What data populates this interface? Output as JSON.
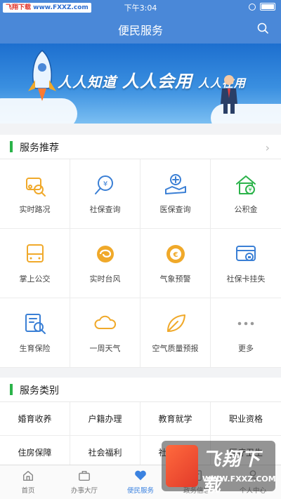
{
  "watermark_top": {
    "brand": "飞翔下载",
    "url": "www.FXXZ.com"
  },
  "status": {
    "time": "下午3:04"
  },
  "header": {
    "title": "便民服务"
  },
  "banner": {
    "slogan_1": "人人知道",
    "slogan_2": "人人会用",
    "slogan_3": "人人在用"
  },
  "recommend": {
    "title": "服务推荐",
    "items": [
      {
        "label": "实时路况",
        "icon": "car-search-icon",
        "color": "#f0a92a"
      },
      {
        "label": "社保查询",
        "icon": "social-security-search-icon",
        "color": "#3a7fd5"
      },
      {
        "label": "医保查询",
        "icon": "medical-insurance-icon",
        "color": "#3a7fd5"
      },
      {
        "label": "公积金",
        "icon": "housing-fund-icon",
        "color": "#2bb34a"
      },
      {
        "label": "掌上公交",
        "icon": "bus-icon",
        "color": "#f0a92a"
      },
      {
        "label": "实时台风",
        "icon": "typhoon-icon",
        "color": "#f0a92a"
      },
      {
        "label": "气象预警",
        "icon": "weather-warning-icon",
        "color": "#f0a92a"
      },
      {
        "label": "社保卡挂失",
        "icon": "card-lock-icon",
        "color": "#3a7fd5"
      },
      {
        "label": "生育保险",
        "icon": "maternity-insurance-icon",
        "color": "#3a7fd5"
      },
      {
        "label": "一周天气",
        "icon": "cloud-icon",
        "color": "#f0a92a"
      },
      {
        "label": "空气质量预报",
        "icon": "leaf-icon",
        "color": "#f0a92a"
      },
      {
        "label": "更多",
        "icon": "more-icon",
        "color": "#999999"
      }
    ]
  },
  "categories": {
    "title": "服务类别",
    "items": [
      "婚育收养",
      "户籍办理",
      "教育就学",
      "职业资格",
      "住房保障",
      "社会福利",
      "社会保险",
      "医疗卫生"
    ]
  },
  "tabs": [
    {
      "label": "首页",
      "icon": "home-icon",
      "active": false
    },
    {
      "label": "办事大厅",
      "icon": "briefcase-icon",
      "active": false
    },
    {
      "label": "便民服务",
      "icon": "heart-icon",
      "active": true
    },
    {
      "label": "政务信息",
      "icon": "news-icon",
      "active": false
    },
    {
      "label": "个人中心",
      "icon": "user-icon",
      "active": false
    }
  ],
  "watermark_bottom": {
    "name": "飞翔下载",
    "url": "WWW.FXXZ.COM"
  }
}
